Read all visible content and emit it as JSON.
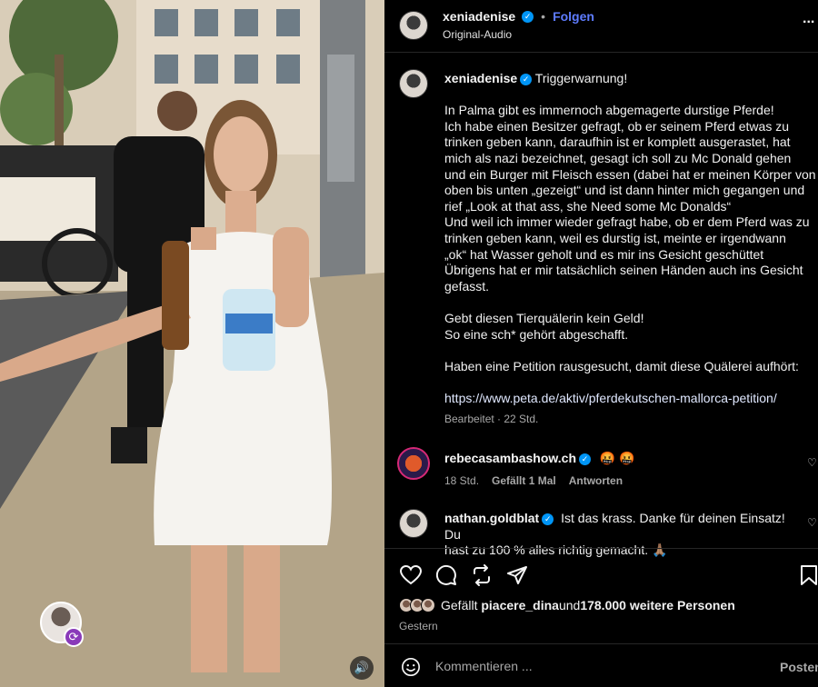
{
  "media": {
    "remix_icon": "remix-icon",
    "sound_icon": "speaker-icon"
  },
  "header": {
    "username": "xeniadenise",
    "separator": "•",
    "follow_label": "Folgen",
    "audio_label": "Original-Audio",
    "more_label": "..."
  },
  "caption": {
    "username": "xeniadenise",
    "lines": [
      "Triggerwarnung!",
      "",
      "In Palma gibt es immernoch abgemagerte durstige Pferde!",
      "Ich habe einen Besitzer gefragt, ob er seinem Pferd etwas zu",
      "trinken geben kann, daraufhin ist er komplett ausgerastet, hat",
      "mich als nazi bezeichnet, gesagt ich soll zu Mc Donald gehen",
      "und ein Burger mit Fleisch essen (dabei hat er meinen Körper von",
      "oben bis unten „gezeigt“ und ist dann hinter mich gegangen und",
      "rief „Look at that ass, she Need some Mc Donalds“",
      "Und weil ich immer wieder gefragt habe, ob er dem Pferd was zu",
      "trinken geben kann, weil es durstig ist, meinte er irgendwann",
      "„ok“ hat Wasser geholt und es mir ins Gesicht geschüttet",
      "Übrigens hat er mir tatsächlich seinen Händen auch ins Gesicht",
      "gefasst.",
      "",
      "Gebt diesen Tierquälerin kein Geld!",
      "So eine sch* gehört abgeschafft.",
      "",
      "Haben eine Petition rausgesucht, damit diese Quälerei aufhört:",
      "",
      "https://www.peta.de/aktiv/pferdekutschen-mallorca-petition/"
    ],
    "meta": "Bearbeitet · 22 Std."
  },
  "comments": [
    {
      "username": "rebecasambashow.ch",
      "text": "🤬 🤬",
      "time": "18 Std.",
      "likes": "Gefällt 1 Mal",
      "reply": "Antworten"
    },
    {
      "username": "nathan.goldblat",
      "text_line1": "Ist das krass. Danke für deinen Einsatz! Du",
      "text_line2": "hast zu 100 % alles richtig gemacht. 🙏🏽"
    }
  ],
  "likes": {
    "prefix": "Gefällt ",
    "user": "piacere_dina",
    "middle": " und ",
    "count": "178.000 weitere Personen"
  },
  "date": "Gestern",
  "compose": {
    "placeholder": "Kommentieren ...",
    "post_label": "Posten"
  },
  "colors": {
    "accent": "#5e7cff",
    "verified": "#0095f6",
    "background": "#000000"
  }
}
